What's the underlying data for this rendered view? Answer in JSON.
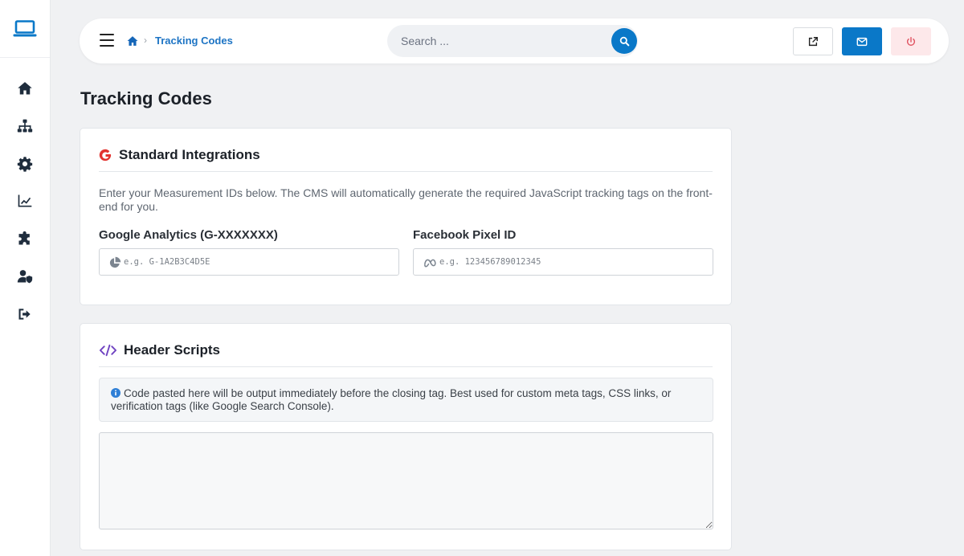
{
  "sidebar": {
    "logo_icon": "laptop-icon",
    "items": [
      {
        "icon": "home-icon"
      },
      {
        "icon": "sitemap-icon"
      },
      {
        "icon": "gear-icon"
      },
      {
        "icon": "chart-line-icon"
      },
      {
        "icon": "puzzle-icon"
      },
      {
        "icon": "user-shield-icon"
      },
      {
        "icon": "sign-out-icon"
      }
    ]
  },
  "topbar": {
    "breadcrumb_sep": "›",
    "breadcrumb_current": "Tracking Codes",
    "search_placeholder": "Search ...",
    "accent_color": "#0a78c8"
  },
  "page": {
    "title": "Tracking Codes"
  },
  "standard_integrations": {
    "title": "Standard Integrations",
    "description": "Enter your Measurement IDs below. The CMS will automatically generate the required JavaScript tracking tags on the front-end for you.",
    "ga_label": "Google Analytics (G-XXXXXXX)",
    "ga_placeholder": "e.g. G-1A2B3C4D5E",
    "fb_label": "Facebook Pixel ID",
    "fb_placeholder": "e.g. 123456789012345"
  },
  "header_scripts": {
    "title": "Header Scripts",
    "info": "Code pasted here will be output immediately before the closing tag. Best used for custom meta tags, CSS links, or verification tags (like Google Search Console).",
    "code_value": ""
  }
}
